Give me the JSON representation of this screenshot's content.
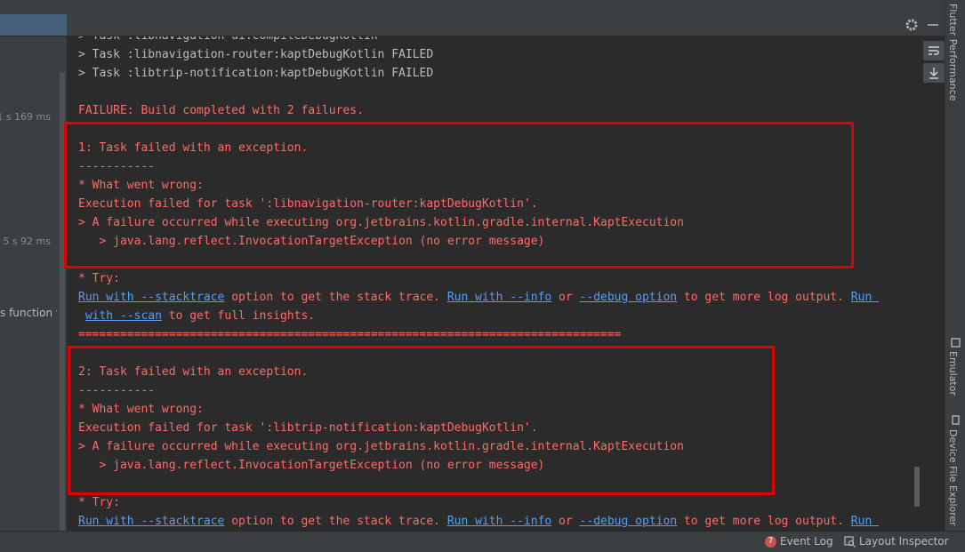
{
  "left_panel": {
    "times": [
      "1 s 169 ms",
      "5 s 92 ms"
    ],
    "label": "s function w"
  },
  "console": {
    "partial_top": "> Task :libnavigation-ui:compileDebugKotlin",
    "lines_failed": [
      "> Task :libnavigation-router:kaptDebugKotlin FAILED",
      "> Task :libtrip-notification:kaptDebugKotlin FAILED"
    ],
    "failure_summary": "FAILURE: Build completed with 2 failures.",
    "failure1": {
      "title": "1: Task failed with an exception.",
      "sep": "-----------",
      "what": "* What went wrong:",
      "execution": "Execution failed for task ':libnavigation-router:kaptDebugKotlin'.",
      "cause": "> A failure occurred while executing org.jetbrains.kotlin.gradle.internal.KaptExecution",
      "subcause": "   > java.lang.reflect.InvocationTargetException (no error message)"
    },
    "try1": {
      "label": "* Try:",
      "link_stacktrace": "Run with --stacktrace",
      "text_option": " option to get the stack trace. ",
      "link_info": "Run with --info",
      "text_or": " or ",
      "link_debug": "--debug option",
      "text_more": " to get more log output. ",
      "link_run": "Run ",
      "link_scan": "with --scan",
      "text_insights": " to get full insights."
    },
    "separator": "==============================================================================",
    "failure2": {
      "title": "2: Task failed with an exception.",
      "sep": "-----------",
      "what": "* What went wrong:",
      "execution": "Execution failed for task ':libtrip-notification:kaptDebugKotlin'.",
      "cause": "> A failure occurred while executing org.jetbrains.kotlin.gradle.internal.KaptExecution",
      "subcause": "   > java.lang.reflect.InvocationTargetException (no error message)"
    },
    "try2": {
      "label": "* Try:",
      "link_stacktrace": "Run with --stacktrace",
      "text_option": " option to get the stack trace. ",
      "link_info": "Run with --info",
      "text_or": " or ",
      "link_debug": "--debug option",
      "text_more": " to get more log output. ",
      "link_run": "Run "
    }
  },
  "right_rail": {
    "flutter_performance": "Flutter Performance",
    "emulator": "Emulator",
    "device_file_explorer": "Device File Explorer"
  },
  "status_bar": {
    "event_log_count": "7",
    "event_log": "Event Log",
    "layout_inspector": "Layout Inspector"
  },
  "colors": {
    "background": "#2b2b2b",
    "error_text": "#ff6b68",
    "link": "#589df6",
    "highlight_box": "#e00000"
  },
  "icons": [
    "gear-icon",
    "soft-wrap-icon",
    "scroll-to-end-icon",
    "emulator-icon",
    "device-file-explorer-icon",
    "event-log-icon",
    "layout-inspector-icon"
  ]
}
